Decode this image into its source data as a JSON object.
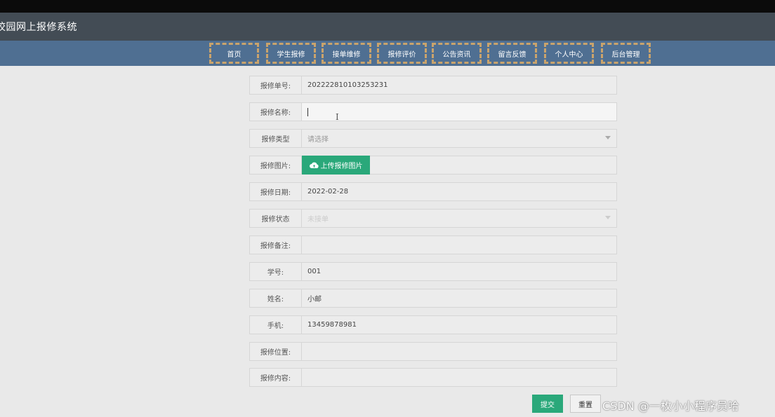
{
  "header": {
    "site_title": "校园网上报修系统"
  },
  "nav": {
    "items": [
      {
        "label": "首页"
      },
      {
        "label": "学生报修"
      },
      {
        "label": "接单维修"
      },
      {
        "label": "报修评价"
      },
      {
        "label": "公告资讯"
      },
      {
        "label": "留言反馈"
      },
      {
        "label": "个人中心"
      },
      {
        "label": "后台管理"
      }
    ]
  },
  "form": {
    "repair_no": {
      "label": "报修单号:",
      "value": "202222810103253231"
    },
    "repair_name": {
      "label": "报修名称:",
      "value": ""
    },
    "repair_type": {
      "label": "报修类型",
      "placeholder": "请选择"
    },
    "repair_image": {
      "label": "报修图片:",
      "upload_label": "上传报修图片"
    },
    "repair_date": {
      "label": "报修日期:",
      "value": "2022-02-28"
    },
    "repair_status": {
      "label": "报修状态",
      "placeholder": "未接单"
    },
    "repair_remark": {
      "label": "报修备注:",
      "value": ""
    },
    "student_id": {
      "label": "学号:",
      "value": "001"
    },
    "name": {
      "label": "姓名:",
      "value": "小邮"
    },
    "phone": {
      "label": "手机:",
      "value": "13459878981"
    },
    "location": {
      "label": "报修位置:",
      "value": ""
    },
    "content": {
      "label": "报修内容:",
      "value": ""
    }
  },
  "actions": {
    "submit_label": "提交",
    "reset_label": "重置"
  },
  "watermark": "CSDN @一枚小小程序员哈",
  "colors": {
    "nav_bg": "#4f6f92",
    "title_bg": "#434c55",
    "accent": "#2aa87a",
    "nav_border": "#c9a36c"
  }
}
